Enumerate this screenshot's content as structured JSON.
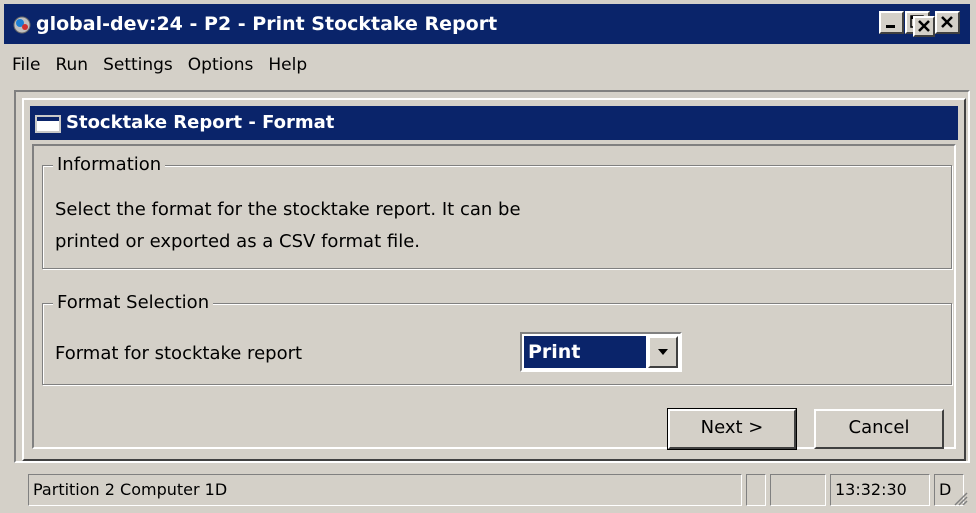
{
  "window": {
    "title": "global-dev:24 - P2 - Print Stocktake Report",
    "controls": {
      "minimize": "minimize-icon",
      "maximize": "maximize-icon",
      "close": "close-icon"
    }
  },
  "menu": [
    "File",
    "Run",
    "Settings",
    "Options",
    "Help"
  ],
  "dialog": {
    "title": "Stocktake Report - Format",
    "information": {
      "legend": "Information",
      "line1": "Select the format for the stocktake report. It can be",
      "line2": "printed or exported as a CSV format file."
    },
    "format_selection": {
      "legend": "Format Selection",
      "label": "Format for stocktake report",
      "selected": "Print"
    },
    "buttons": {
      "next": "Next >",
      "cancel": "Cancel"
    }
  },
  "statusbar": {
    "partition": "Partition 2 Computer 1D",
    "time": "13:32:30",
    "extra": "D"
  },
  "colors": {
    "titlebar": "#0a246a",
    "face": "#d4d0c8"
  }
}
